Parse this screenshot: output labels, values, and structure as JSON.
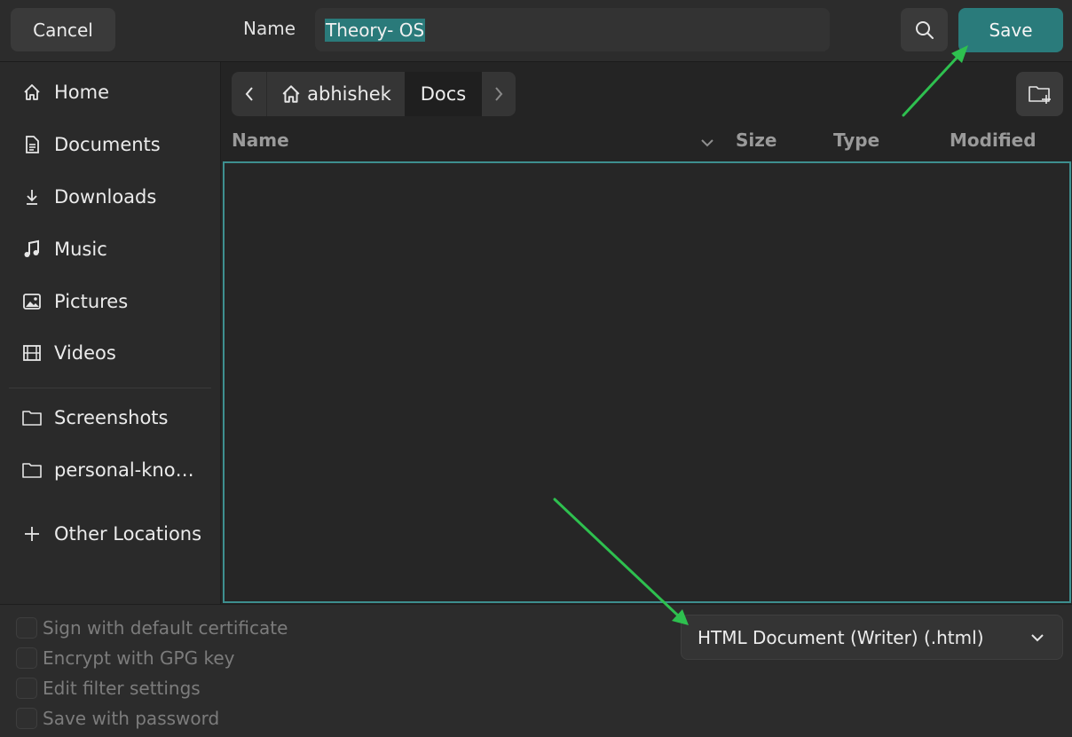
{
  "header": {
    "cancel_label": "Cancel",
    "name_label": "Name",
    "name_value": "Theory- OS",
    "save_label": "Save"
  },
  "sidebar": {
    "items": [
      {
        "label": "Home",
        "icon": "home-icon"
      },
      {
        "label": "Documents",
        "icon": "document-icon"
      },
      {
        "label": "Downloads",
        "icon": "download-icon"
      },
      {
        "label": "Music",
        "icon": "music-icon"
      },
      {
        "label": "Pictures",
        "icon": "picture-icon"
      },
      {
        "label": "Videos",
        "icon": "video-icon"
      },
      {
        "label": "Screenshots",
        "icon": "folder-icon"
      },
      {
        "label": "personal-kno…",
        "icon": "folder-icon"
      },
      {
        "label": "Other Locations",
        "icon": "plus-icon"
      }
    ]
  },
  "pathbar": {
    "home_label": "abhishek",
    "current_label": "Docs"
  },
  "columns": {
    "name": "Name",
    "size": "Size",
    "type": "Type",
    "modified": "Modified"
  },
  "options": {
    "sign": "Sign with default certificate",
    "encrypt": "Encrypt with GPG key",
    "edit_filter": "Edit filter settings",
    "password": "Save with password"
  },
  "filter": {
    "selected": "HTML Document (Writer) (.html)"
  },
  "colors": {
    "accent": "#2a7b7b",
    "annotation_arrow": "#2ec04f"
  }
}
